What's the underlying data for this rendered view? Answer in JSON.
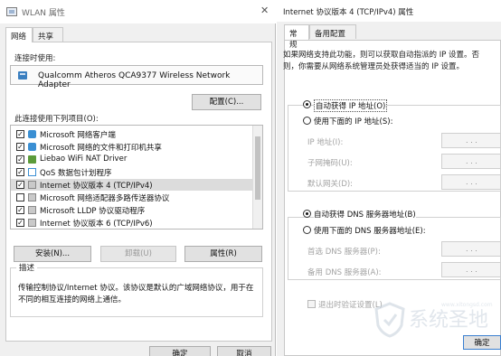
{
  "left_window": {
    "title": "WLAN 属性",
    "close_glyph": "✕",
    "tabs": [
      "网络",
      "共享"
    ],
    "connect_using_label": "连接时使用:",
    "adapter_name": "Qualcomm Atheros QCA9377 Wireless Network Adapter",
    "configure_button": "配置(C)...",
    "items_label": "此连接使用下列项目(O):",
    "items": [
      {
        "label": "Microsoft 网络客户端",
        "checked": true,
        "icon": "network-client-icon"
      },
      {
        "label": "Microsoft 网络的文件和打印机共享",
        "checked": true,
        "icon": "file-share-icon"
      },
      {
        "label": "Liebao WiFi NAT Driver",
        "checked": true,
        "icon": "driver-icon"
      },
      {
        "label": "QoS 数据包计划程序",
        "checked": true,
        "icon": "qos-icon"
      },
      {
        "label": "Internet 协议版本 4 (TCP/IPv4)",
        "checked": true,
        "icon": "protocol-icon"
      },
      {
        "label": "Microsoft 网络适配器多路传送器协议",
        "checked": false,
        "icon": "protocol-icon"
      },
      {
        "label": "Microsoft LLDP 协议驱动程序",
        "checked": true,
        "icon": "protocol-icon"
      },
      {
        "label": "Internet 协议版本 6 (TCP/IPv6)",
        "checked": true,
        "icon": "protocol-icon"
      }
    ],
    "install_button": "安装(N)...",
    "uninstall_button": "卸载(U)",
    "properties_button": "属性(R)",
    "description_legend": "描述",
    "description_text": "传输控制协议/Internet 协议。该协议是默认的广域网络协议，用于在不同的相互连接的网络上通信。",
    "ok_button": "确定",
    "cancel_button": "取消"
  },
  "right_window": {
    "title": "Internet 协议版本 4 (TCP/IPv4) 属性",
    "tabs": [
      "常规",
      "备用配置"
    ],
    "info_text": "如果网络支持此功能，则可以获取自动指派的 IP 设置。否则，你需要从网络系统管理员处获得适当的 IP 设置。",
    "auto_ip_label": "自动获得 IP 地址(O)",
    "manual_ip_label": "使用下面的 IP 地址(S):",
    "ip_label": "IP 地址(I):",
    "subnet_label": "子网掩码(U):",
    "gateway_label": "默认网关(D):",
    "auto_dns_label": "自动获得 DNS 服务器地址(B)",
    "manual_dns_label": "使用下面的 DNS 服务器地址(E):",
    "preferred_dns_label": "首选 DNS 服务器(P):",
    "alternate_dns_label": "备用 DNS 服务器(A):",
    "validate_label": "退出时验证设置(L)",
    "ok_button": "确定",
    "ip_dots": ". . ."
  },
  "watermark": {
    "text": "系统圣地",
    "sub": "www.xitongsd.com"
  }
}
